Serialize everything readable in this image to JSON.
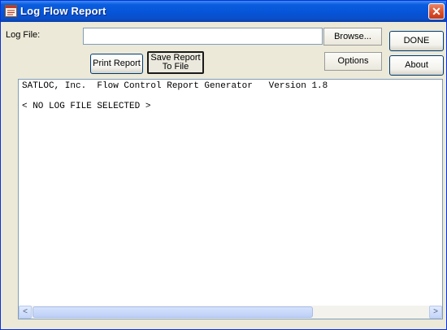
{
  "window": {
    "title": "Log Flow Report",
    "close_glyph": "✕"
  },
  "form": {
    "log_file_label": "Log File:",
    "log_file_value": "",
    "browse_label": "Browse...",
    "done_label": "DONE",
    "print_report_label": "Print Report",
    "save_report_label_line1": "Save Report",
    "save_report_label_line2": "To File",
    "options_label": "Options",
    "about_label": "About"
  },
  "output": {
    "header_line": "SATLOC, Inc.  Flow Control Report Generator   Version 1.8",
    "status_line": "< NO LOG FILE SELECTED >"
  },
  "scrollbar": {
    "left_arrow": "<",
    "right_arrow": ">"
  },
  "icons": {
    "app": "log-report-app-icon",
    "close": "close-icon",
    "scroll_left": "scroll-left-arrow-icon",
    "scroll_right": "scroll-right-arrow-icon"
  },
  "colors": {
    "titlebar": "#0653d6",
    "window_bg": "#ece9d8",
    "close_button": "#d9512c"
  }
}
